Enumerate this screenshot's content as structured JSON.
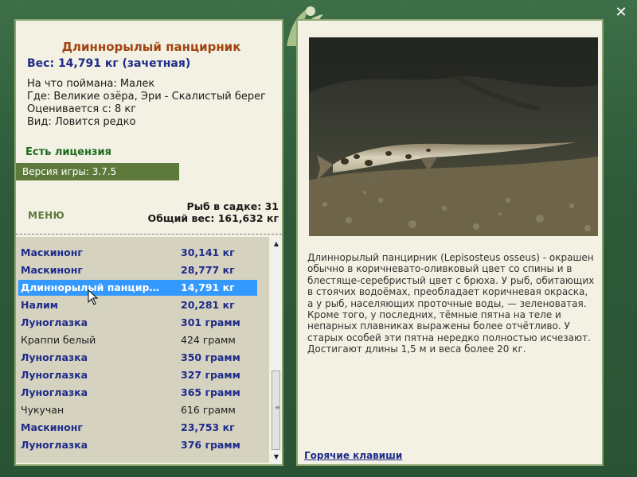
{
  "fish": {
    "title": "Длиннорылый панцирник",
    "weight": "Вес: 14,791 кг (зачетная)",
    "caught_on": "На что поймана: Малек",
    "location": "Где: Великие озёра, Эри - Скалистый берег",
    "rated_from": "Оценивается с: 8 кг",
    "kind": "Вид: Ловится редко"
  },
  "license": "Есть лицензия",
  "version": "Версия игры: 3.7.5",
  "menu_label": "МЕНЮ",
  "stats": {
    "count": "Рыб в садке: 31",
    "total": "Общий вес: 161,632 кг"
  },
  "catch_list": [
    {
      "name": "Маскинонг",
      "weight": "30,141 кг",
      "style": "bold"
    },
    {
      "name": "Маскинонг",
      "weight": "28,777 кг",
      "style": "bold"
    },
    {
      "name": "Длиннорылый панцирник",
      "weight": "14,791 кг",
      "style": "selected"
    },
    {
      "name": "Налим",
      "weight": "20,281 кг",
      "style": "bold"
    },
    {
      "name": "Луноглазка",
      "weight": "301 грамм",
      "style": "bold"
    },
    {
      "name": "Краппи белый",
      "weight": "424 грамм",
      "style": "plain"
    },
    {
      "name": "Луноглазка",
      "weight": "350 грамм",
      "style": "bold"
    },
    {
      "name": "Луноглазка",
      "weight": "327 грамм",
      "style": "bold"
    },
    {
      "name": "Луноглазка",
      "weight": "365 грамм",
      "style": "bold"
    },
    {
      "name": "Чукучан",
      "weight": "616 грамм",
      "style": "plain"
    },
    {
      "name": "Маскинонг",
      "weight": "23,753 кг",
      "style": "bold"
    },
    {
      "name": "Луноглазка",
      "weight": "376 грамм",
      "style": "bold"
    }
  ],
  "description": "Длиннорылый панцирник (Lepisosteus osseus) - окрашен обычно в коричневато-оливковый цвет со спины и в блестяще-серебристый цвет с брюха. У рыб, обитающих в стоячих водоёмах, преобладает коричневая окраска, а у рыб, населяющих проточные воды, — зеленоватая. Кроме того, у последних, тёмные пятна на теле и непарных плавниках выражены более отчётливо. У старых особей эти пятна нередко полностью исчезают. Достигают длины 1,5 м и веса более 20 кг.",
  "hotkeys_label": "Горячие клавиши",
  "icons": {
    "close": "close-icon",
    "logo": "leaf-logo-icon",
    "scroll_up": "scroll-up-arrow-icon",
    "scroll_down": "scroll-down-arrow-icon",
    "cursor": "mouse-pointer-icon"
  },
  "colors": {
    "frame": "#2f5f3c",
    "panel": "#f3f1e3",
    "title": "#a0430f",
    "weight": "#1f2b8a",
    "license": "#1f6b1f",
    "version_bar": "#5d7a3c",
    "selection": "#3399ff"
  }
}
